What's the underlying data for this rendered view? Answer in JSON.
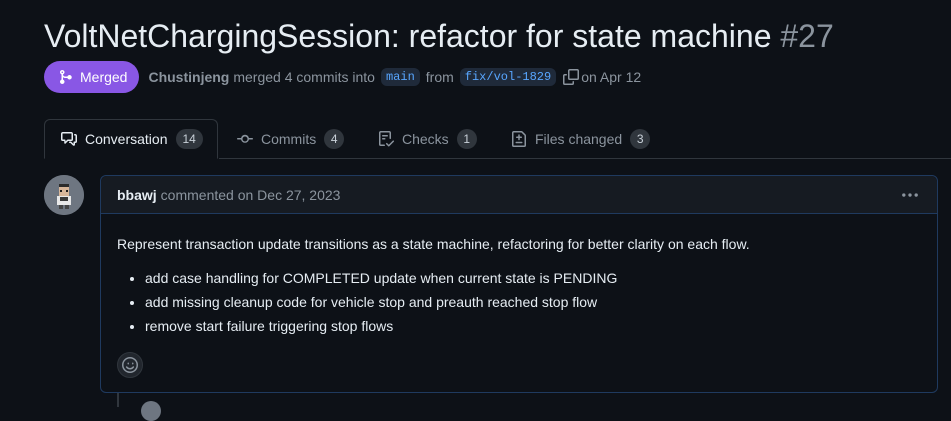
{
  "pr": {
    "title": "VoltNetChargingSession: refactor for state machine",
    "number": "#27",
    "status": "Merged",
    "author": "Chustinjeng",
    "merge_text": "merged 4 commits into",
    "base_branch": "main",
    "from_text": "from",
    "head_branch": "fix/vol-1829",
    "date_text": "on Apr 12"
  },
  "tabs": [
    {
      "label": "Conversation",
      "count": "14",
      "icon": "comment-discussion-icon"
    },
    {
      "label": "Commits",
      "count": "4",
      "icon": "git-commit-icon"
    },
    {
      "label": "Checks",
      "count": "1",
      "icon": "checklist-icon"
    },
    {
      "label": "Files changed",
      "count": "3",
      "icon": "file-diff-icon"
    }
  ],
  "comment": {
    "user": "bbawj",
    "action": "commented on Dec 27, 2023",
    "body": "Represent transaction update transitions as a state machine, refactoring for better clarity on each flow.",
    "bullets": [
      "add case handling for COMPLETED update when current state is PENDING",
      "add missing cleanup code for vehicle stop and preauth reached stop flow",
      "remove start failure triggering stop flows"
    ]
  },
  "colors": {
    "background": "#0d1117",
    "merged_badge": "#8957e5",
    "branch_link": "#58a6ff",
    "comment_border": "#1f3a5f"
  }
}
